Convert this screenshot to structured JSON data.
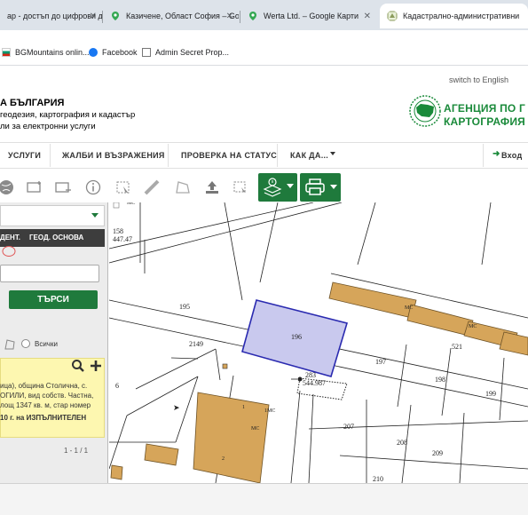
{
  "browser": {
    "tabs": [
      {
        "label": "ар - достъп до цифрови д",
        "active": false,
        "favicon": "globe-icon"
      },
      {
        "label": "Казичене, Област София – Goo",
        "active": false,
        "favicon": "google-maps-icon"
      },
      {
        "label": "Werta Ltd. – Google Карти",
        "active": false,
        "favicon": "google-maps-icon"
      },
      {
        "label": "Кадастрално-административни",
        "active": true,
        "favicon": "cadastre-icon"
      }
    ],
    "bookmarks": [
      {
        "label": "BGMountains onlin...",
        "icon": "flag-icon"
      },
      {
        "label": "Facebook",
        "icon": "facebook-icon"
      },
      {
        "label": "Admin Secret Prop...",
        "icon": "page-icon"
      }
    ]
  },
  "header": {
    "title": "А БЪЛГАРИЯ",
    "subtitle1": "геодезия, картография и кадастър",
    "subtitle2": "ли за електронни услуги",
    "switch_lang": "switch to English",
    "agency_line1": "АГЕНЦИЯ ПО Г",
    "agency_line2": "КАРТОГРАФИЯ"
  },
  "nav": {
    "items": [
      "УСЛУГИ",
      "ЖАЛБИ И ВЪЗРАЖЕНИЯ",
      "ПРОВЕРКА НА СТАТУС",
      "КАК ДА..."
    ],
    "login": "Вход"
  },
  "panel": {
    "tab1": "ДЕНТ.",
    "tab2": "ГЕОД. ОСНОВА",
    "search_button": "ТЪРСИ",
    "all_label": "Всички",
    "result_lines": [
      "ица), община Столична, с.",
      "ОГИЛИ, вид собств. Частна,",
      "лощ 1347 кв. м, стар номер",
      "10 г. на ИЗПЪЛНИТЕЛЕН"
    ],
    "pagination": "1 - 1 / 1"
  },
  "map": {
    "labels": [
      "158",
      "447.47",
      "195",
      "2149",
      "196",
      "197",
      "521",
      "198",
      "199",
      "283",
      "544.987",
      "6",
      "207",
      "208",
      "209",
      "210",
      "МС",
      "1МС",
      "МС",
      "МС",
      "МС",
      "1",
      "2"
    ],
    "highlight_color": "#c9c9ee",
    "building_color": "#d6a55a"
  },
  "colors": {
    "green": "#1f7a3c",
    "tab_bg": "#dde3ea"
  }
}
